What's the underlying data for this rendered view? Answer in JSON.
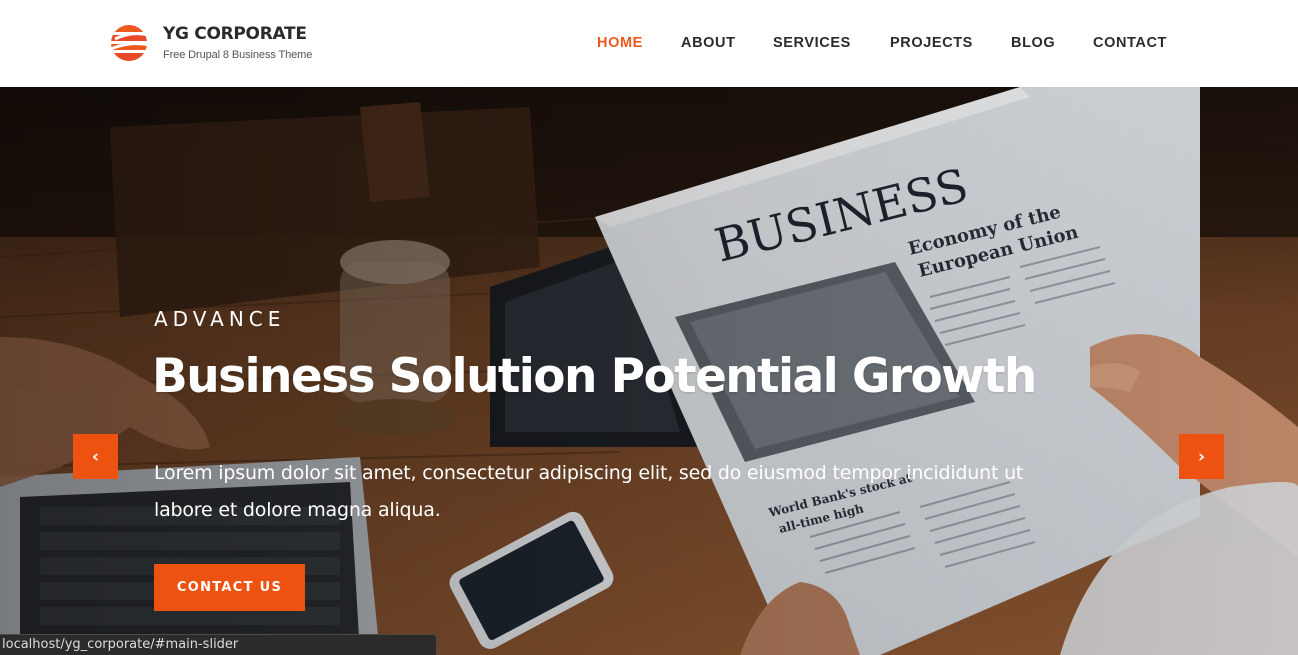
{
  "brand": {
    "name": "YG CORPORATE",
    "tagline": "Free Drupal 8 Business Theme",
    "logo_icon": "striped-globe-icon",
    "accent_color": "#ee5210"
  },
  "nav": {
    "items": [
      {
        "label": "HOME",
        "active": true
      },
      {
        "label": "ABOUT",
        "active": false
      },
      {
        "label": "SERVICES",
        "active": false
      },
      {
        "label": "PROJECTS",
        "active": false
      },
      {
        "label": "BLOG",
        "active": false
      },
      {
        "label": "CONTACT",
        "active": false
      }
    ]
  },
  "slider": {
    "eyebrow": "ADVANCE",
    "title": "Business Solution Potential Growth",
    "text_line1": "Lorem ipsum dolor sit amet, consectetur adipiscing elit, sed do eiusmod tempor incididunt ut",
    "text_line2": "labore et dolore magna aliqua.",
    "cta_label": "CONTACT US",
    "prev_icon": "chevron-left-icon",
    "next_icon": "chevron-right-icon",
    "prev_glyph": "‹",
    "next_glyph": "›"
  },
  "status_bar": {
    "url": "localhost/yg_corporate/#main-slider"
  }
}
